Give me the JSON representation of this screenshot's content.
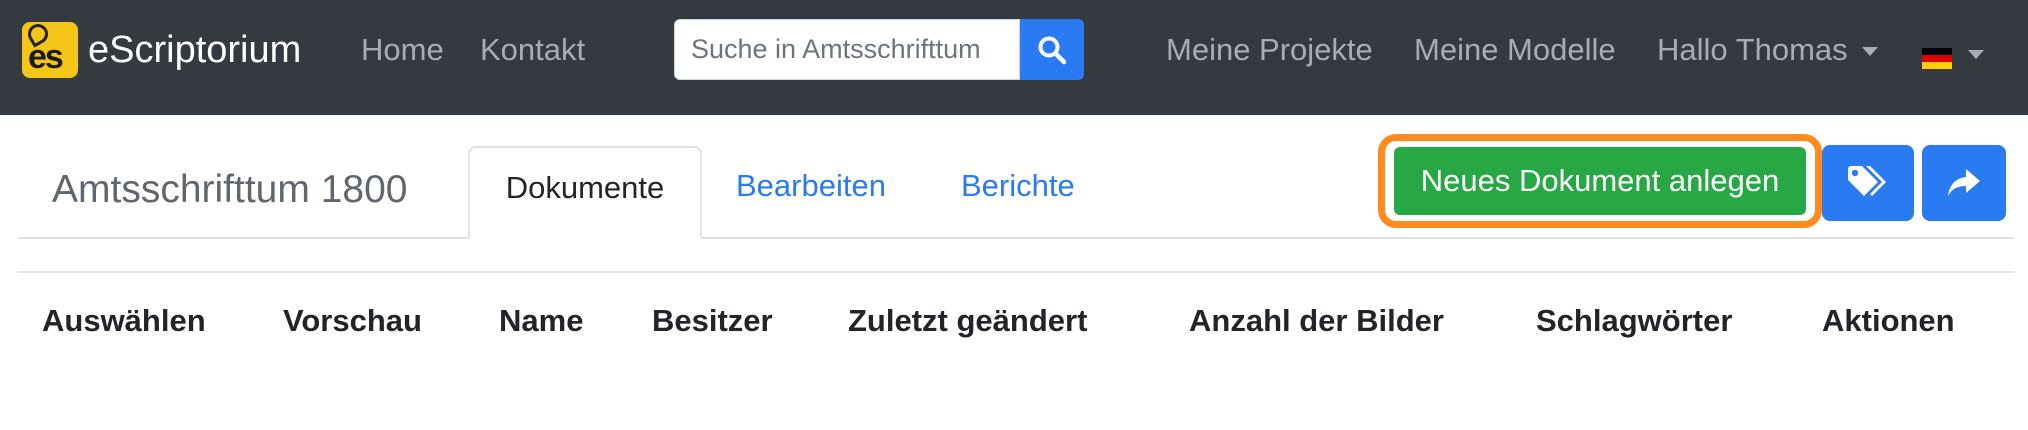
{
  "navbar": {
    "brand": "eScriptorium",
    "links": {
      "home": "Home",
      "contact": "Kontakt"
    },
    "search": {
      "placeholder": "Suche in Amtsschrifttum",
      "value": ""
    },
    "right": {
      "projects": "Meine Projekte",
      "models": "Meine Modelle",
      "user": "Hallo Thomas"
    },
    "colors": {
      "background": "#343a40",
      "link": "#a9adb1",
      "primary": "#2a7bf2"
    }
  },
  "project": {
    "title": "Amtsschrifttum 1800",
    "tabs": [
      {
        "label": "Dokumente",
        "active": true
      },
      {
        "label": "Bearbeiten",
        "active": false
      },
      {
        "label": "Berichte",
        "active": false
      }
    ]
  },
  "actions": {
    "new_document": "Neues Dokument anlegen",
    "tags_icon": "tags-icon",
    "share_icon": "share-icon",
    "colors": {
      "success": "#28a745",
      "highlight": "#ff8a1e"
    }
  },
  "table": {
    "columns": [
      "Auswählen",
      "Vorschau",
      "Name",
      "Besitzer",
      "Zuletzt geändert",
      "Anzahl der Bilder",
      "Schlagwörter",
      "Aktionen"
    ]
  }
}
